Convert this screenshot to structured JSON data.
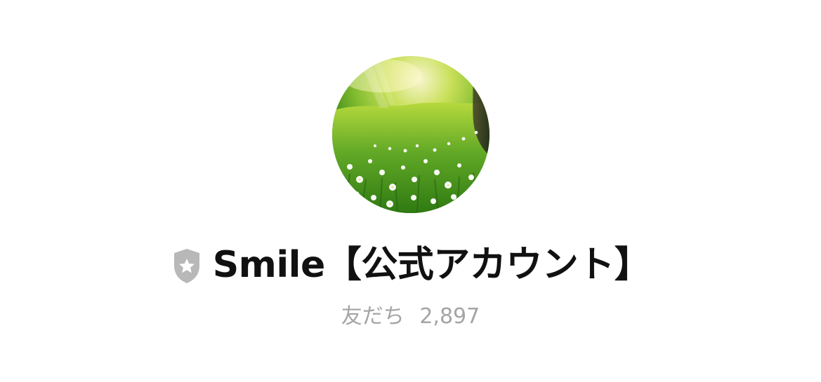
{
  "profile": {
    "name": "Smile【公式アカウント】",
    "friends_label": "友だち",
    "friends_count": "2,897",
    "badge_icon": "shield-star-icon",
    "avatar_description": "photo of white flowers in green grass",
    "colors": {
      "name": "#111111",
      "friends_text": "#a4a4a4",
      "badge": "#b8b8b8"
    }
  }
}
